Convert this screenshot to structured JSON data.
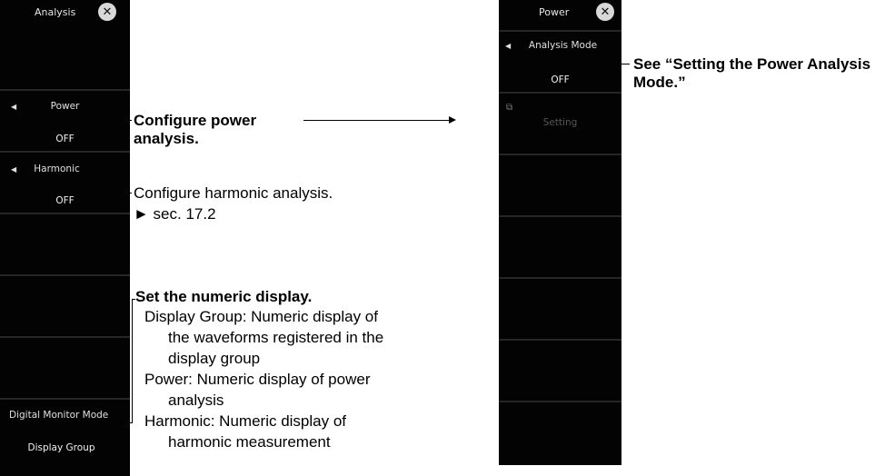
{
  "left_panel": {
    "title": "Analysis",
    "items": [
      {
        "label": "Power",
        "value": "OFF"
      },
      {
        "label": "Harmonic",
        "value": "OFF"
      },
      {
        "label": "Digital Monitor Mode",
        "value": "Display Group"
      }
    ]
  },
  "right_panel": {
    "title": "Power",
    "items": [
      {
        "label": "Analysis Mode",
        "value": "OFF"
      },
      {
        "label": "Setting"
      }
    ]
  },
  "annotations": {
    "power": "Configure power analysis.",
    "harmonic_line1": "Configure harmonic analysis.",
    "harmonic_line2": "► sec. 17.2",
    "numeric_title": "Set the numeric display.",
    "numeric_lines": [
      "Display Group: Numeric display of",
      "the waveforms registered in the",
      "display group",
      "Power: Numeric display of power",
      "analysis",
      "Harmonic: Numeric display of",
      "harmonic measurement"
    ],
    "see_power_mode": "See “Setting the Power Analysis Mode.”"
  },
  "icons": {
    "close": "close-icon",
    "left_arrow": "left-arrow-icon",
    "setting": "setting-icon"
  }
}
